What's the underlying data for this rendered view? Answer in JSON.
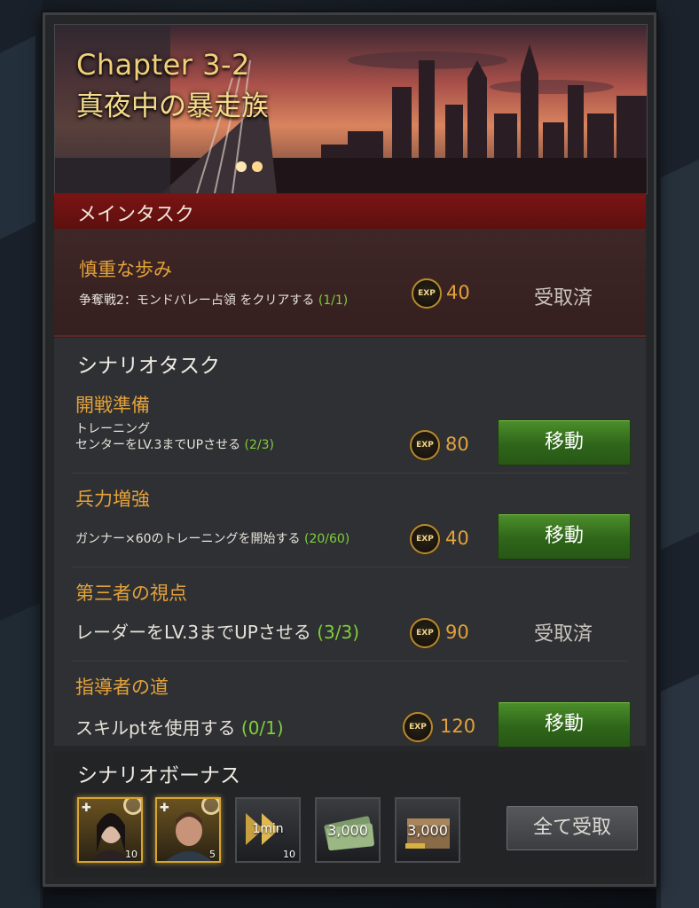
{
  "chapter": {
    "title": "Chapter 3-2",
    "subtitle": "真夜中の暴走族"
  },
  "main_section": {
    "header": "メインタスク",
    "task": {
      "name": "慎重な歩み",
      "desc": "争奪戦2：モンドバレー占領 をクリアする",
      "progress": "(1/1)",
      "exp": "40",
      "status": "受取済"
    }
  },
  "scenario_section": {
    "header": "シナリオタスク",
    "tasks": [
      {
        "name": "開戦準備",
        "desc_line1": "トレーニング",
        "desc_line2": "センターをLV.3までUPさせる",
        "progress": "(2/3)",
        "exp": "80",
        "action": "移動"
      },
      {
        "name": "兵力増強",
        "desc": "ガンナー×60のトレーニングを開始する",
        "progress": "(20/60)",
        "exp": "40",
        "action": "移動"
      },
      {
        "name": "第三者の視点",
        "desc": "レーダーをLV.3までUPさせる",
        "progress": "(3/3)",
        "exp": "90",
        "status": "受取済"
      },
      {
        "name": "指導者の道",
        "desc": "スキルptを使用する",
        "progress": "(0/1)",
        "exp": "120",
        "action": "移動"
      }
    ]
  },
  "exp_icon_label": "EXP",
  "bonus": {
    "header": "シナリオボーナス",
    "items": [
      {
        "icon": "hero-woman-card-icon",
        "qty": "10"
      },
      {
        "icon": "hero-man-card-icon",
        "qty": "5"
      },
      {
        "icon": "speedup-icon",
        "label": "1min",
        "qty": "10"
      },
      {
        "icon": "cash-bundle-icon",
        "label": "3,000"
      },
      {
        "icon": "supply-crate-icon",
        "label": "3,000"
      }
    ],
    "claim_all": "全て受取"
  },
  "colors": {
    "accent_gold": "#e3a23a",
    "progress_green": "#7ecf3a",
    "move_button": "#3f7d22",
    "main_header_red": "#6e1212"
  }
}
